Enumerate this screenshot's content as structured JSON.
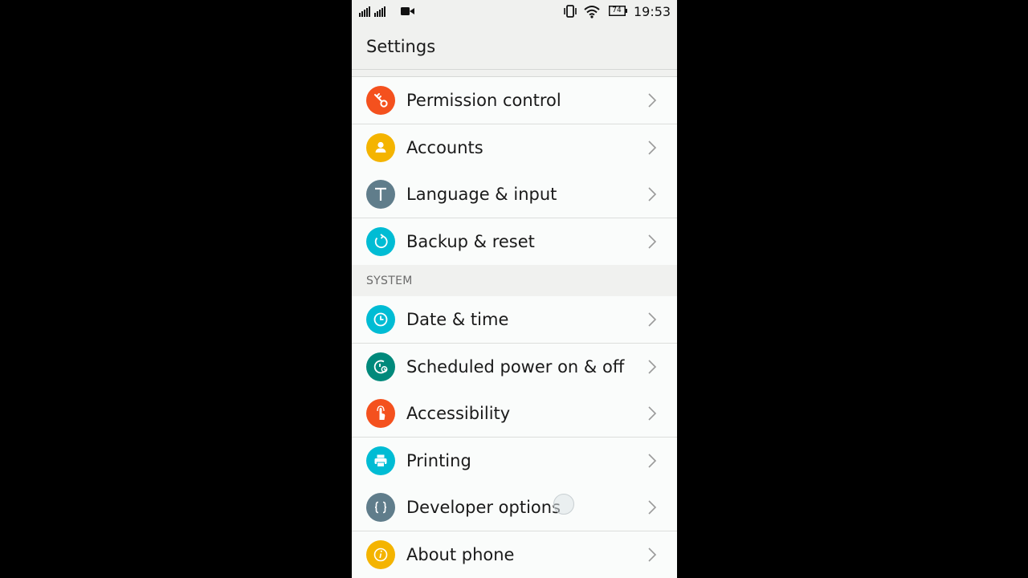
{
  "status_bar": {
    "time": "19:53",
    "battery_level": "74",
    "icons": [
      "signal-icon",
      "video-record-icon",
      "vibrate-icon",
      "wifi-icon",
      "battery-icon"
    ]
  },
  "app_bar": {
    "title": "Settings"
  },
  "colors": {
    "orange": "#f4511e",
    "amber": "#f4b400",
    "slate": "#607d8b",
    "cyan": "#00bcd4",
    "teal": "#00897b",
    "yellow": "#f4b400"
  },
  "items_top": [
    {
      "label": "Permission control",
      "icon": "key-icon",
      "color": "#f4511e"
    },
    {
      "label": "Accounts",
      "icon": "account-icon",
      "color": "#f4b400"
    },
    {
      "label": "Language & input",
      "icon": "language-icon",
      "color": "#607d8b"
    },
    {
      "label": "Backup & reset",
      "icon": "backup-icon",
      "color": "#00bcd4"
    }
  ],
  "section": {
    "label": "SYSTEM"
  },
  "items_system": [
    {
      "label": "Date & time",
      "icon": "clock-icon",
      "color": "#00bcd4"
    },
    {
      "label": "Scheduled power on & off",
      "icon": "scheduled-power-icon",
      "color": "#00897b"
    },
    {
      "label": "Accessibility",
      "icon": "accessibility-icon",
      "color": "#f4511e"
    },
    {
      "label": "Printing",
      "icon": "printer-icon",
      "color": "#00bcd4"
    },
    {
      "label": "Developer options",
      "icon": "developer-icon",
      "color": "#607d8b"
    },
    {
      "label": "About phone",
      "icon": "info-icon",
      "color": "#f4b400"
    }
  ]
}
